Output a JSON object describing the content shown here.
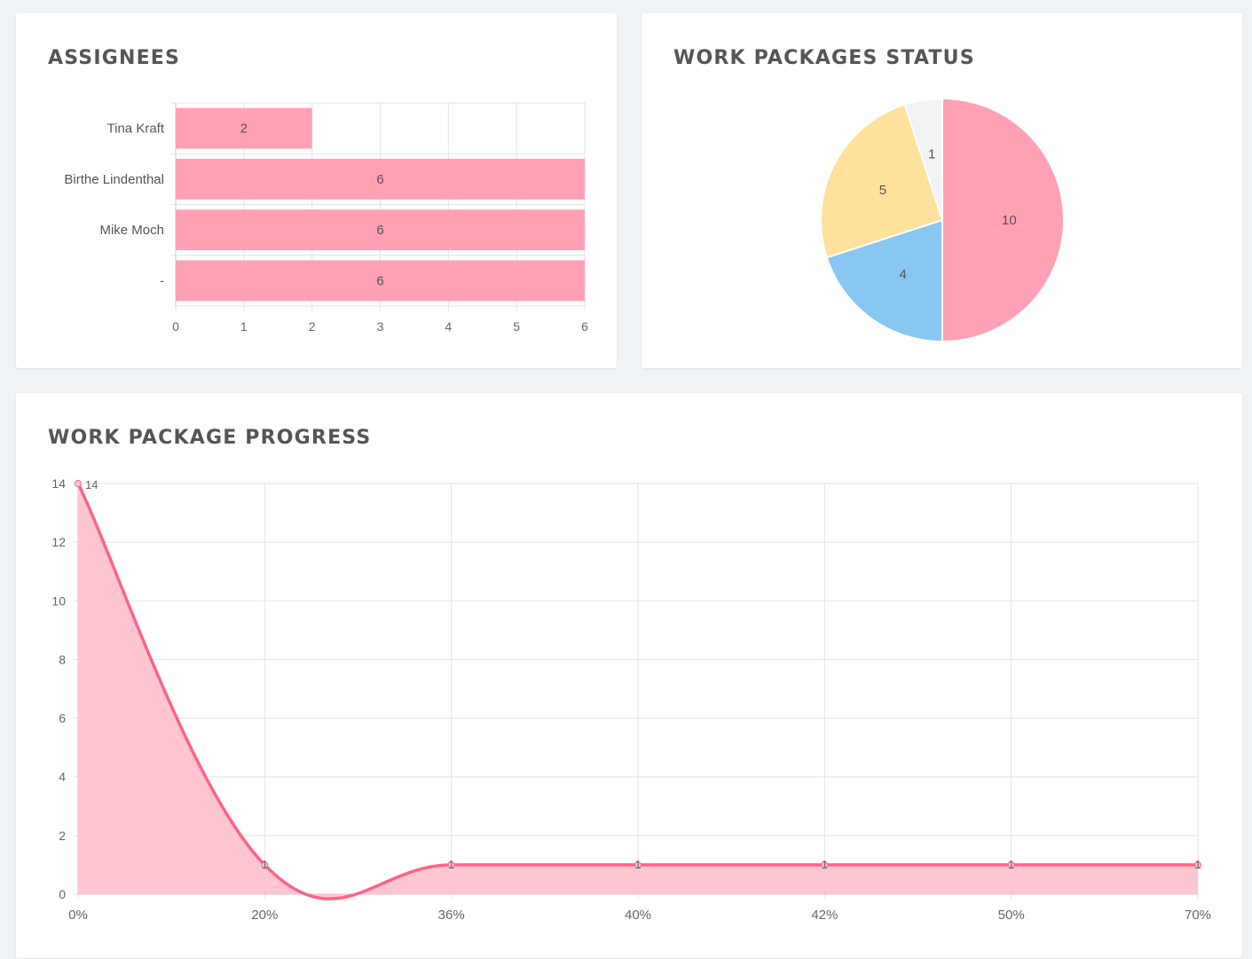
{
  "assignees": {
    "title": "ASSIGNEES",
    "chart_data": {
      "type": "bar",
      "orientation": "horizontal",
      "categories": [
        "Tina Kraft",
        "Birthe Lindenthal",
        "Mike Moch",
        "-"
      ],
      "values": [
        2,
        6,
        6,
        6
      ],
      "xlim": [
        0,
        6
      ],
      "xticks": [
        0,
        1,
        2,
        3,
        4,
        5,
        6
      ],
      "grid": true,
      "data_labels": true,
      "color": "#ffa0b4",
      "border_color": "#ff6384"
    }
  },
  "status": {
    "title": "WORK PACKAGES STATUS",
    "chart_data": {
      "type": "pie",
      "values": [
        10,
        4,
        5,
        1
      ],
      "colors": [
        "#ffa0b4",
        "#87c7f2",
        "#ffe19c",
        "#f2f3f4"
      ],
      "data_labels": true
    }
  },
  "progress": {
    "title": "WORK PACKAGE PROGRESS",
    "chart_data": {
      "type": "area",
      "categories": [
        "0%",
        "20%",
        "36%",
        "40%",
        "42%",
        "50%",
        "70%"
      ],
      "values": [
        14,
        1,
        1,
        1,
        1,
        1,
        1
      ],
      "ylim": [
        0,
        14
      ],
      "yticks": [
        0,
        2,
        4,
        6,
        8,
        10,
        12,
        14
      ],
      "grid": true,
      "data_labels": true,
      "line_color": "#ff6384",
      "fill_color": "#ffc3d0"
    }
  }
}
